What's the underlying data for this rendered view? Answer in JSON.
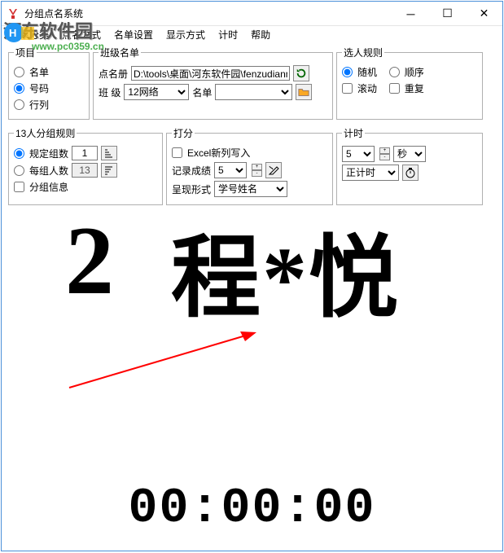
{
  "window": {
    "title": "分组点名系统"
  },
  "menu": {
    "category": "菜单分类",
    "method": "点名方式",
    "setting": "名单设置",
    "display": "显示方式",
    "timer": "计时",
    "help": "帮助"
  },
  "watermark": {
    "text": "河东软件园",
    "url": "www.pc0359.cn"
  },
  "project": {
    "legend": "项目",
    "opt1": "名单",
    "opt2": "号码",
    "opt3": "行列"
  },
  "namelist": {
    "legend": "班级名单",
    "filelabel": "点名册",
    "filepath": "D:\\tools\\桌面\\河东软件园\\fenzudianm",
    "classlabel": "班  级",
    "classvalue": "12网络",
    "listlabel": "名单",
    "listvalue": ""
  },
  "selectrule": {
    "legend": "选人规则",
    "random": "随机",
    "order": "顺序",
    "scroll": "滚动",
    "repeat": "重复"
  },
  "grouprule": {
    "legend": "13人分组规则",
    "countlabel": "规定组数",
    "countval": "1",
    "perlabel": "每组人数",
    "perval": "13",
    "infolabel": "分组信息"
  },
  "score": {
    "legend": "打分",
    "excel": "Excel新列写入",
    "recordlabel": "记录成绩",
    "recordval": "5",
    "showlabel": "呈现形式",
    "showval": "学号姓名"
  },
  "timing": {
    "legend": "计时",
    "val": "5",
    "unit": "秒",
    "mode": "正计时"
  },
  "result": {
    "number": "2",
    "name": "程*悦"
  },
  "clock": "00:00:00"
}
